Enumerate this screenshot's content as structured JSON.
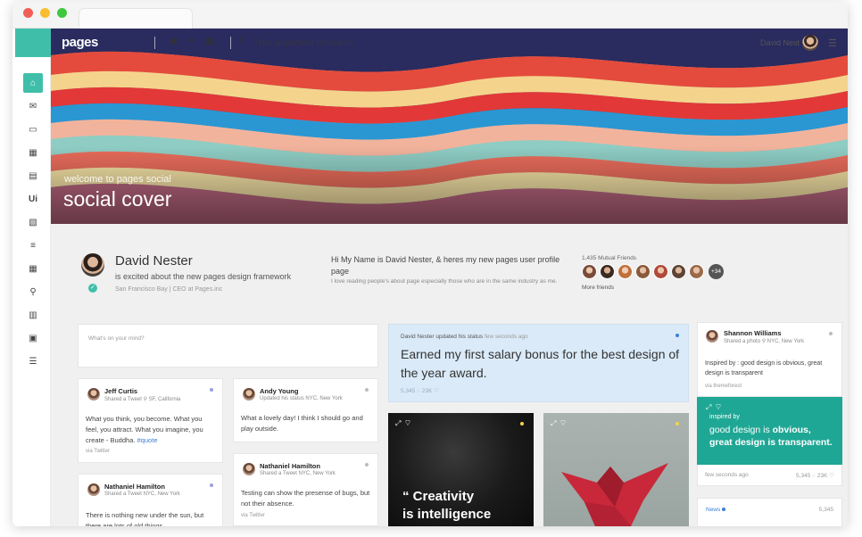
{
  "app": {
    "logo": "pages",
    "search_placeholder": "Type anywhere to search",
    "user_name": "David Nest"
  },
  "sidebar": {
    "items": [
      {
        "icon": "home-icon",
        "glyph": "⌂"
      },
      {
        "icon": "mail-icon",
        "glyph": "✉"
      },
      {
        "icon": "chat-icon",
        "glyph": "▭"
      },
      {
        "icon": "calendar-icon",
        "glyph": "▦"
      },
      {
        "icon": "layout-icon",
        "glyph": "▤"
      },
      {
        "icon": "ui-icon",
        "glyph": "Ui"
      },
      {
        "icon": "document-icon",
        "glyph": "▧"
      },
      {
        "icon": "list-icon",
        "glyph": "≡"
      },
      {
        "icon": "table-icon",
        "glyph": "▦"
      },
      {
        "icon": "map-pin-icon",
        "glyph": "⚲"
      },
      {
        "icon": "chart-icon",
        "glyph": "▥"
      },
      {
        "icon": "briefcase-icon",
        "glyph": "▣"
      },
      {
        "icon": "menu-list-icon",
        "glyph": "☰"
      }
    ]
  },
  "cover": {
    "subtitle": "welcome to pages social",
    "title": "social cover"
  },
  "profile": {
    "name": "David Nester",
    "tagline": "is excited about the new pages design framework",
    "location": "San Francisco Bay | CEO at Pages.inc",
    "bio": "Hi My Name is David Nester, & heres my new pages user profile page",
    "bio_sub": "I love reading people's about page especially those who are in the same industry as me.",
    "mutual_friends": "1,435 Mutual Friends",
    "more_count": "+34",
    "more_friends": "More friends"
  },
  "status_box": {
    "placeholder": "What's on your mind?"
  },
  "feed": {
    "jeff": {
      "name": "Jeff Curtis",
      "meta": "Shared a Tweet ⚲ SF, California",
      "body": "What you think, you become. What you feel, you attract. What you imagine, you create - Buddha.",
      "tag": "#quote",
      "via": "via Twitter"
    },
    "nathaniel1": {
      "name": "Nathaniel Hamilton",
      "meta": "Shared a Tweet NYC, New York",
      "body": "There is nothing new under the sun, but there are lots of old things"
    },
    "andy": {
      "name": "Andy Young",
      "meta": "Updated his status NYC, New York",
      "body": "What a lovely day! I think I should go and play outside."
    },
    "nathaniel2": {
      "name": "Nathaniel Hamilton",
      "meta": "Shared a Tweet NYC, New York",
      "body": "Testing can show the presense of bugs, but not their absence.",
      "via": "via Twitter"
    },
    "big_status": {
      "author": "David Nester updated his status",
      "time": "few seconds ago",
      "text": "Earned my first salary bonus for the best design of the year award.",
      "stats": "5,345 ◌ 23K ♡"
    },
    "quote_image": {
      "text_line1": "“ Creativity",
      "text_line2": "is intelligence"
    },
    "shannon": {
      "name": "Shannon Williams",
      "meta": "Shared a photo ⚲ NYC, New York",
      "body": "Inspired by : good design is obvious, great design is transparent",
      "via": "via themeforest"
    },
    "teal": {
      "small": "inspired by",
      "line1_a": "good design is ",
      "line1_b": "obvious,",
      "line2_a": "great design is ",
      "line2_b": "transparent."
    },
    "teal_stats": {
      "time": "few seconds ago",
      "counts": "5,345 ◌ 23K ♡"
    },
    "news": {
      "label": "News",
      "count": "5,345"
    }
  }
}
